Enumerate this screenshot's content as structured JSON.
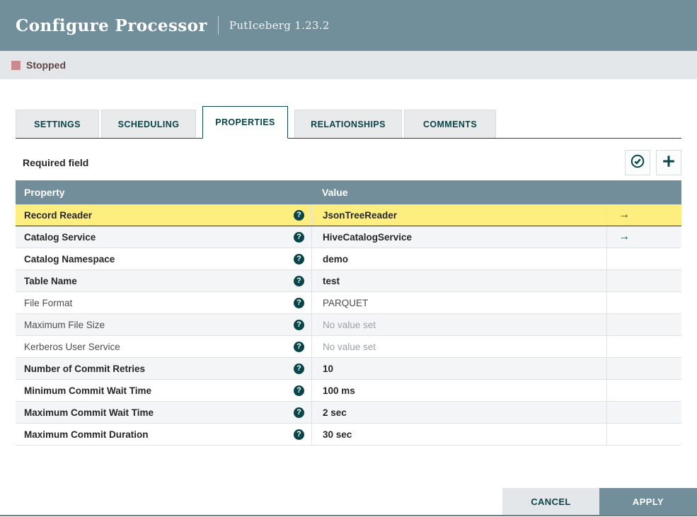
{
  "header": {
    "title": "Configure Processor",
    "subtitle": "PutIceberg 1.23.2"
  },
  "status": {
    "label": "Stopped",
    "color": "#ca8a8e"
  },
  "tabs": [
    {
      "label": "SETTINGS",
      "active": false
    },
    {
      "label": "SCHEDULING",
      "active": false
    },
    {
      "label": "PROPERTIES",
      "active": true
    },
    {
      "label": "RELATIONSHIPS",
      "active": false
    },
    {
      "label": "COMMENTS",
      "active": false
    }
  ],
  "toolbar": {
    "required_label": "Required field",
    "verify_icon": "verification-check-circle-icon",
    "add_icon": "add-property-plus-icon"
  },
  "table": {
    "columns": {
      "property": "Property",
      "value": "Value"
    },
    "rows": [
      {
        "property": "Record Reader",
        "value": "JsonTreeReader",
        "required": true,
        "selected": true,
        "goto": "→"
      },
      {
        "property": "Catalog Service",
        "value": "HiveCatalogService",
        "required": true,
        "selected": false,
        "goto": "→"
      },
      {
        "property": "Catalog Namespace",
        "value": "demo",
        "required": true,
        "selected": false,
        "goto": ""
      },
      {
        "property": "Table Name",
        "value": "test",
        "required": true,
        "selected": false,
        "goto": ""
      },
      {
        "property": "File Format",
        "value": "PARQUET",
        "required": false,
        "selected": false,
        "goto": ""
      },
      {
        "property": "Maximum File Size",
        "value": "No value set",
        "required": false,
        "selected": false,
        "goto": "",
        "empty": true
      },
      {
        "property": "Kerberos User Service",
        "value": "No value set",
        "required": false,
        "selected": false,
        "goto": "",
        "empty": true
      },
      {
        "property": "Number of Commit Retries",
        "value": "10",
        "required": true,
        "selected": false,
        "goto": ""
      },
      {
        "property": "Minimum Commit Wait Time",
        "value": "100 ms",
        "required": true,
        "selected": false,
        "goto": ""
      },
      {
        "property": "Maximum Commit Wait Time",
        "value": "2 sec",
        "required": true,
        "selected": false,
        "goto": ""
      },
      {
        "property": "Maximum Commit Duration",
        "value": "30 sec",
        "required": true,
        "selected": false,
        "goto": ""
      }
    ],
    "help_glyph": "?"
  },
  "footer": {
    "cancel_label": "CANCEL",
    "apply_label": "APPLY"
  },
  "colors": {
    "header_bg": "#718f9b",
    "table_header_bg": "#728e9b",
    "accent_teal": "#07454b",
    "selected_row": "#fdee7f",
    "stripe": "#f3f5f6",
    "status_square": "#ca8a8e",
    "status_text": "#5e4444",
    "muted_value": "#9ba1a6"
  }
}
